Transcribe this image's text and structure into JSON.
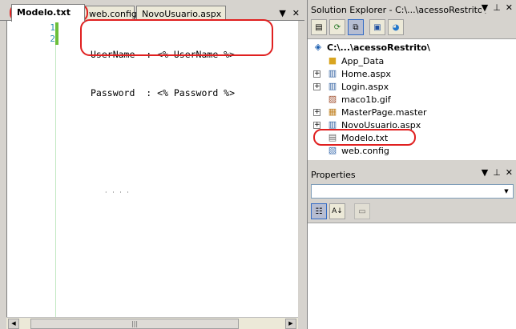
{
  "editor": {
    "tabs": [
      {
        "label": "Modelo.txt"
      },
      {
        "label": "web.config"
      },
      {
        "label": "NovoUsuario.aspx"
      }
    ],
    "line_numbers": [
      "1",
      "2"
    ],
    "code_lines": [
      "UserName  : <% UserName %>",
      "Password  : <% Password %>"
    ],
    "tab_controls": {
      "dropdown": "▼",
      "close": "✕"
    }
  },
  "solution_explorer": {
    "title": "Solution Explorer - C:\\...\\acessoRestrito\\",
    "title_controls": {
      "dropdown": "▼",
      "pin": "⊥",
      "close": "✕"
    },
    "root": "C:\\...\\acessoRestrito\\",
    "items": [
      {
        "label": "App_Data",
        "icon": "folder-icon",
        "expandable": false
      },
      {
        "label": "Home.aspx",
        "icon": "aspx-file-icon",
        "expandable": true
      },
      {
        "label": "Login.aspx",
        "icon": "aspx-file-icon",
        "expandable": true
      },
      {
        "label": "maco1b.gif",
        "icon": "image-file-icon",
        "expandable": false
      },
      {
        "label": "MasterPage.master",
        "icon": "master-file-icon",
        "expandable": true
      },
      {
        "label": "NovoUsuario.aspx",
        "icon": "aspx-file-icon",
        "expandable": true
      },
      {
        "label": "Modelo.txt",
        "icon": "text-file-icon",
        "expandable": false
      },
      {
        "label": "web.config",
        "icon": "config-file-icon",
        "expandable": false
      }
    ]
  },
  "properties": {
    "title": "Properties",
    "title_controls": {
      "dropdown": "▼",
      "pin": "⊥",
      "close": "✕"
    }
  },
  "colors": {
    "annotation": "#e02020",
    "line_number": "#2b91af",
    "change_bar": "#6cbf3a"
  }
}
